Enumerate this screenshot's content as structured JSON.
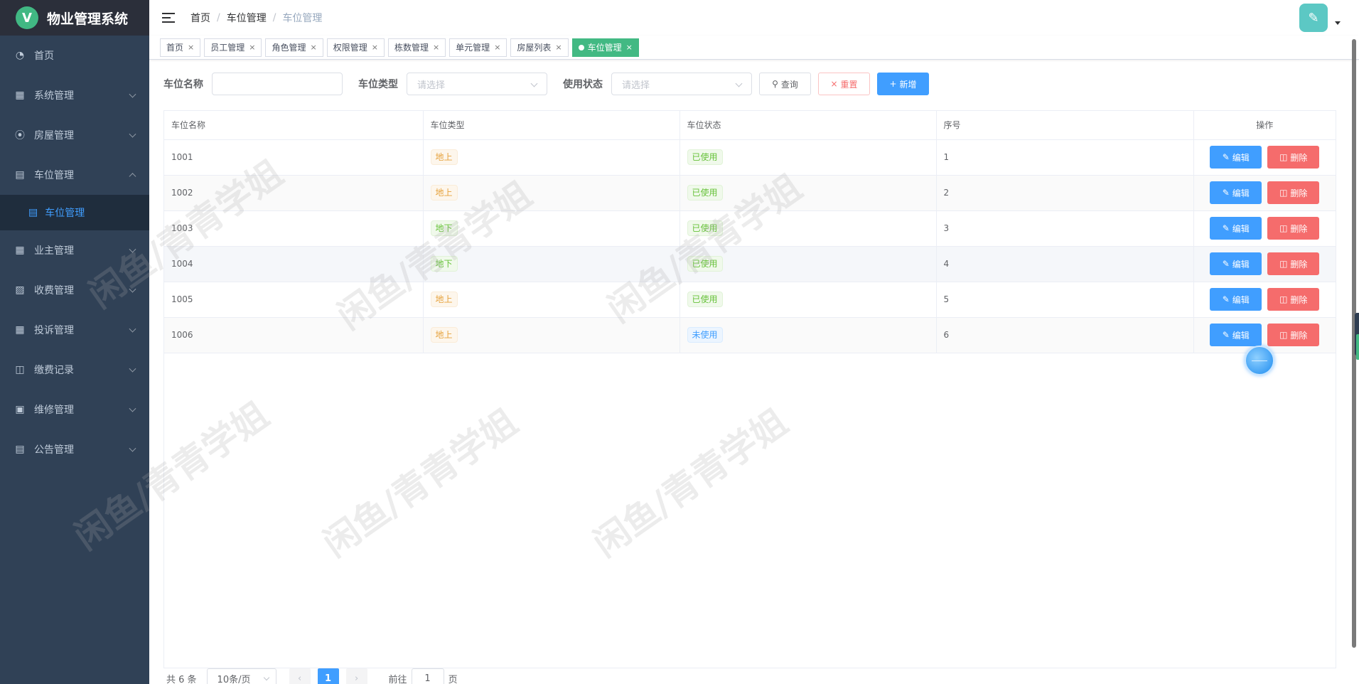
{
  "app": {
    "title": "物业管理系统",
    "logo_letter": "V"
  },
  "sidebar": {
    "items": [
      {
        "label": "首页",
        "icon": "dashboard-icon",
        "has_arrow": false
      },
      {
        "label": "系统管理",
        "icon": "grid-icon",
        "has_arrow": true
      },
      {
        "label": "房屋管理",
        "icon": "home-icon",
        "has_arrow": true
      },
      {
        "label": "车位管理",
        "icon": "parking-icon",
        "has_arrow": true,
        "open": true,
        "children": [
          {
            "label": "车位管理",
            "icon": "parking-icon",
            "active": true
          }
        ]
      },
      {
        "label": "业主管理",
        "icon": "table-icon",
        "has_arrow": true
      },
      {
        "label": "收费管理",
        "icon": "fee-icon",
        "has_arrow": true
      },
      {
        "label": "投诉管理",
        "icon": "calendar-icon",
        "has_arrow": true
      },
      {
        "label": "缴费记录",
        "icon": "record-icon",
        "has_arrow": true
      },
      {
        "label": "维修管理",
        "icon": "image-icon",
        "has_arrow": true
      },
      {
        "label": "公告管理",
        "icon": "notice-icon",
        "has_arrow": true
      }
    ]
  },
  "breadcrumb": [
    "首页",
    "车位管理",
    "车位管理"
  ],
  "tags": [
    {
      "label": "首页"
    },
    {
      "label": "员工管理"
    },
    {
      "label": "角色管理"
    },
    {
      "label": "权限管理"
    },
    {
      "label": "栋数管理"
    },
    {
      "label": "单元管理"
    },
    {
      "label": "房屋列表"
    },
    {
      "label": "车位管理",
      "active": true
    }
  ],
  "filter": {
    "name_label": "车位名称",
    "name_value": "",
    "type_label": "车位类型",
    "type_placeholder": "请选择",
    "status_label": "使用状态",
    "status_placeholder": "请选择",
    "search_label": "查询",
    "reset_label": "重置",
    "add_label": "新增"
  },
  "table": {
    "columns": [
      "车位名称",
      "车位类型",
      "车位状态",
      "序号",
      "操作"
    ],
    "edit_label": "编辑",
    "delete_label": "删除",
    "rows": [
      {
        "name": "1001",
        "type": "地上",
        "type_style": "warning",
        "status": "已使用",
        "status_style": "success",
        "seq": "1"
      },
      {
        "name": "1002",
        "type": "地上",
        "type_style": "warning",
        "status": "已使用",
        "status_style": "success",
        "seq": "2"
      },
      {
        "name": "1003",
        "type": "地下",
        "type_style": "success",
        "status": "已使用",
        "status_style": "success",
        "seq": "3"
      },
      {
        "name": "1004",
        "type": "地下",
        "type_style": "success",
        "status": "已使用",
        "status_style": "success",
        "seq": "4"
      },
      {
        "name": "1005",
        "type": "地上",
        "type_style": "warning",
        "status": "已使用",
        "status_style": "success",
        "seq": "5"
      },
      {
        "name": "1006",
        "type": "地上",
        "type_style": "warning",
        "status": "未使用",
        "status_style": "info",
        "seq": "6"
      }
    ]
  },
  "pagination": {
    "total_text": "共 6 条",
    "page_size": "10条/页",
    "current_page": "1",
    "goto_prefix": "前往",
    "goto_value": "1",
    "goto_suffix": "页"
  },
  "watermark": "闲鱼/青青学姐",
  "colors": {
    "sidebar_bg": "#304156",
    "primary": "#409eff",
    "danger": "#f56c6c",
    "active_tag": "#42b983"
  }
}
